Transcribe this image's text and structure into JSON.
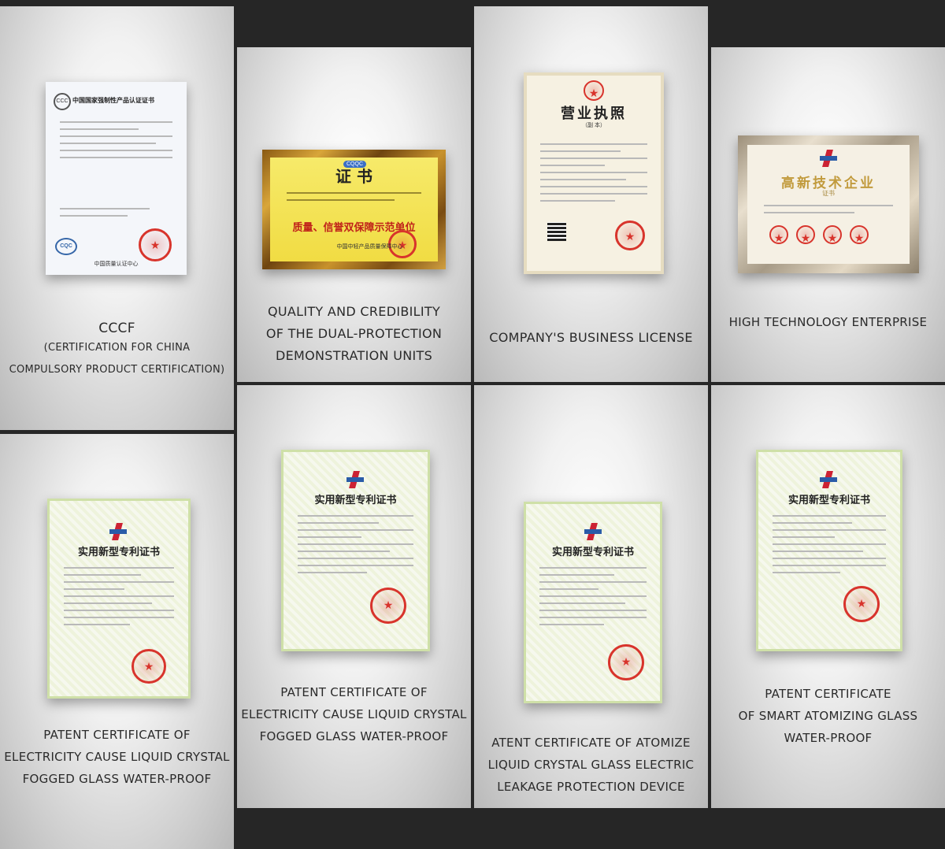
{
  "certificates": [
    {
      "caption": [
        "CCCF",
        "(CERTIFICATION FOR CHINA",
        "COMPULSORY PRODUCT CERTIFICATION)"
      ],
      "doc_title": "中国国家强制性产品认证证书",
      "doc_footer": "中国质量认证中心",
      "badge": "CQC"
    },
    {
      "caption": [
        "QUALITY AND CREDIBILITY",
        "OF THE DUAL-PROTECTION",
        "DEMONSTRATION UNITS"
      ],
      "doc_title": "证 书",
      "doc_subtitle": "质量、信誉双保障示范单位",
      "doc_footer": "中国中轻产品质量保障中心",
      "badge": "CQQC"
    },
    {
      "caption": [
        "COMPANY'S BUSINESS LICENSE"
      ],
      "doc_title": "营业执照",
      "doc_subtitle": "（副 本）"
    },
    {
      "caption": [
        "HIGH TECHNOLOGY ENTERPRISE"
      ],
      "doc_title": "高新技术企业",
      "doc_subtitle": "证书"
    },
    {
      "caption": [
        "PATENT CERTIFICATE OF",
        "ELECTRICITY CAUSE LIQUID CRYSTAL",
        "FOGGED GLASS WATER-PROOF"
      ],
      "doc_title": "实用新型专利证书"
    },
    {
      "caption": [
        "PATENT CERTIFICATE OF",
        "ELECTRICITY CAUSE LIQUID CRYSTAL",
        "FOGGED GLASS WATER-PROOF"
      ],
      "doc_title": "实用新型专利证书"
    },
    {
      "caption": [
        "ATENT CERTIFICATE OF ATOMIZE",
        "LIQUID CRYSTAL GLASS ELECTRIC",
        "LEAKAGE PROTECTION DEVICE"
      ],
      "doc_title": "实用新型专利证书"
    },
    {
      "caption": [
        "PATENT CERTIFICATE",
        "OF SMART ATOMIZING GLASS",
        "WATER-PROOF"
      ],
      "doc_title": "实用新型专利证书"
    }
  ],
  "colors": {
    "background": "#262626",
    "seal": "#d8342c",
    "gold_plate": "#f3e25a"
  }
}
